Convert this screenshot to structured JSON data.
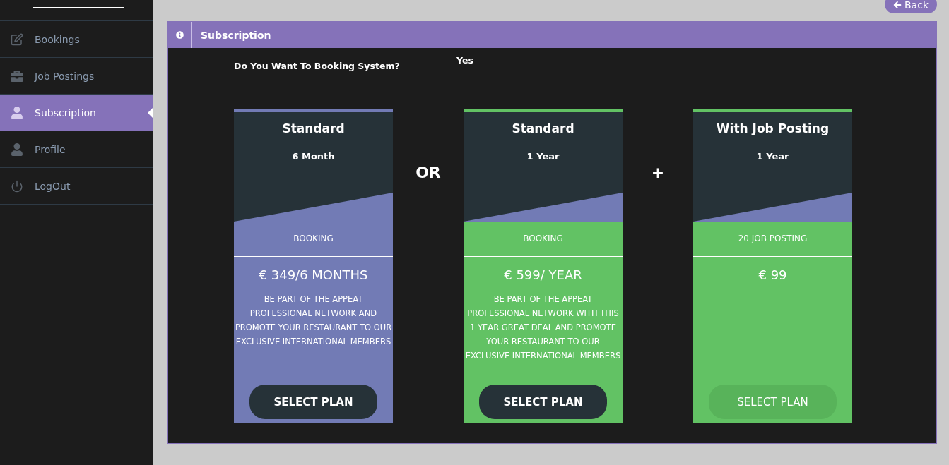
{
  "sidebar": {
    "items": [
      {
        "label": "Bookings",
        "selected": false
      },
      {
        "label": "Job Postings",
        "selected": false
      },
      {
        "label": "Subscription",
        "selected": true
      },
      {
        "label": "Profile",
        "selected": false
      },
      {
        "label": "LogOut",
        "selected": false
      }
    ]
  },
  "back_button": {
    "label": "Back"
  },
  "panel": {
    "title": "Subscription",
    "question": "Do You Want To Booking System?",
    "answer": "Yes"
  },
  "plans": [
    {
      "title": "Standard",
      "period": "6 Month",
      "feature": "BOOKING",
      "price": "€ 349/6 MONTHS",
      "description": "BE PART OF THE APPEAT PROFESSIONAL NETWORK AND PROMOTE YOUR RESTAURANT TO OUR EXCLUSIVE INTERNATIONAL MEMBERS",
      "color": "#727bb5",
      "button": {
        "label": "SELECT PLAN",
        "disabled": false
      },
      "separator_after": "OR"
    },
    {
      "title": "Standard",
      "period": "1 Year",
      "feature": "BOOKING",
      "price": "€ 599/ YEAR",
      "description": "BE PART OF THE APPEAT PROFESSIONAL NETWORK WITH THIS 1 YEAR GREAT DEAL AND PROMOTE YOUR RESTAURANT TO OUR EXCLUSIVE INTERNATIONAL MEMBERS",
      "color": "#62c264",
      "button": {
        "label": "SELECT PLAN",
        "disabled": false
      },
      "separator_after": "+"
    },
    {
      "title": "With Job Posting",
      "period": "1 Year",
      "feature": "20 JOB POSTING",
      "price": "€ 99",
      "color": "#62c264",
      "button": {
        "label": "SELECT PLAN",
        "disabled": true
      }
    }
  ]
}
